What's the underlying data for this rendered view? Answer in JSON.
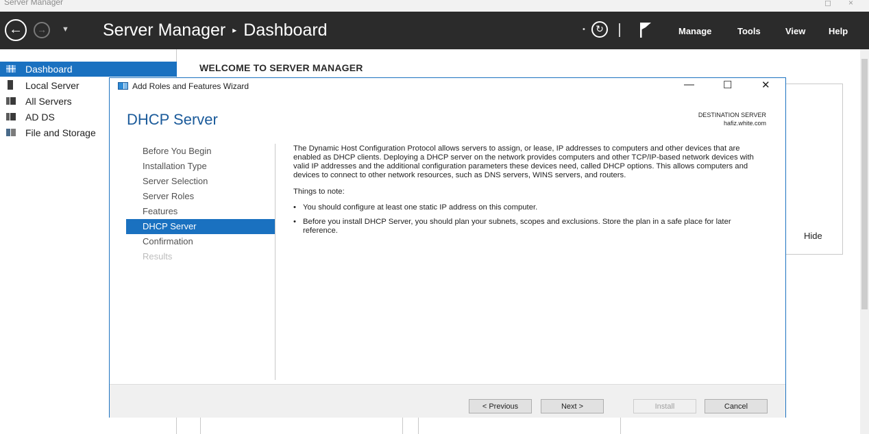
{
  "window": {
    "app_title": "Server Manager",
    "minimize_glyph": "◻",
    "close_glyph": "×"
  },
  "header": {
    "back_glyph": "←",
    "forward_glyph": "→",
    "dropdown_glyph": "▼",
    "breadcrumb_root": "Server Manager",
    "breadcrumb_separator": "▸",
    "breadcrumb_current": "Dashboard",
    "refresh_dropdown_glyph": "•",
    "refresh_glyph": "↻",
    "menu": [
      "Manage",
      "Tools",
      "View",
      "Help"
    ]
  },
  "sidebar": {
    "items": [
      {
        "label": "Dashboard",
        "icon": "dashboard-grid-icon",
        "selected": true
      },
      {
        "label": "Local Server",
        "icon": "server-icon"
      },
      {
        "label": "All Servers",
        "icon": "servers-icon"
      },
      {
        "label": "AD DS",
        "icon": "ad-ds-icon"
      },
      {
        "label": "File and Storage",
        "icon": "file-storage-icon"
      }
    ]
  },
  "main": {
    "welcome_heading": "WELCOME TO SERVER MANAGER",
    "hide_label": "Hide"
  },
  "wizard": {
    "title": "Add Roles and Features Wizard",
    "minimize_glyph": "—",
    "maximize_glyph": "☐",
    "close_glyph": "✕",
    "page_heading": "DHCP Server",
    "destination_label": "DESTINATION SERVER",
    "destination_server": "hafiz.white.com",
    "steps": [
      {
        "label": "Before You Begin",
        "state": "normal"
      },
      {
        "label": "Installation Type",
        "state": "normal"
      },
      {
        "label": "Server Selection",
        "state": "normal"
      },
      {
        "label": "Server Roles",
        "state": "normal"
      },
      {
        "label": "Features",
        "state": "normal"
      },
      {
        "label": "DHCP Server",
        "state": "active"
      },
      {
        "label": "Confirmation",
        "state": "normal"
      },
      {
        "label": "Results",
        "state": "disabled"
      }
    ],
    "description": "The Dynamic Host Configuration Protocol allows servers to assign, or lease, IP addresses to computers and other devices that are enabled as DHCP clients. Deploying a DHCP server on the network provides computers and other TCP/IP-based network devices with valid IP addresses and the additional configuration parameters these devices need, called DHCP options. This allows computers and devices to connect to other network resources, such as DNS servers, WINS servers, and routers.",
    "things_to_note_label": "Things to note:",
    "notes": [
      "You should configure at least one static IP address on this computer.",
      "Before you install DHCP Server, you should plan your subnets, scopes and exclusions. Store the plan in a safe place for later reference."
    ],
    "buttons": {
      "previous": "< Previous",
      "next": "Next >",
      "install": "Install",
      "cancel": "Cancel"
    }
  },
  "colors": {
    "header_bg": "#2b2b2b",
    "selection_blue": "#1a71c0",
    "heading_blue": "#1a5a9a",
    "footer_bg": "#f0f0f0"
  }
}
